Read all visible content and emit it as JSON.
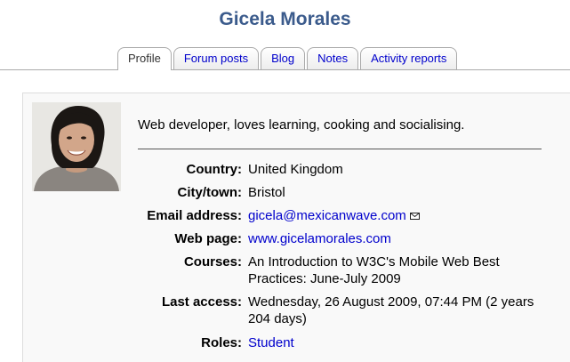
{
  "profile": {
    "name": "Gicela Morales",
    "description": "Web developer, loves learning, cooking and socialising."
  },
  "tabs": [
    {
      "label": "Profile",
      "active": true
    },
    {
      "label": "Forum posts",
      "active": false
    },
    {
      "label": "Blog",
      "active": false
    },
    {
      "label": "Notes",
      "active": false
    },
    {
      "label": "Activity reports",
      "active": false
    }
  ],
  "details": {
    "country": {
      "label": "Country:",
      "value": "United Kingdom"
    },
    "city": {
      "label": "City/town:",
      "value": "Bristol"
    },
    "email": {
      "label": "Email address:",
      "value": "gicela@mexicanwave.com",
      "icon": "envelope-icon"
    },
    "webpage": {
      "label": "Web page:",
      "value": "www.gicelamorales.com"
    },
    "courses": {
      "label": "Courses:",
      "value": "An Introduction to W3C's Mobile Web Best Practices: June-July 2009"
    },
    "last_access": {
      "label": "Last access:",
      "value": "Wednesday, 26 August 2009, 07:44 PM  (2 years 204 days)"
    },
    "roles": {
      "label": "Roles:",
      "value": "Student"
    }
  },
  "colors": {
    "title": "#3b5b8c",
    "link": "#0000cc",
    "card_background": "#f9f9f9"
  }
}
